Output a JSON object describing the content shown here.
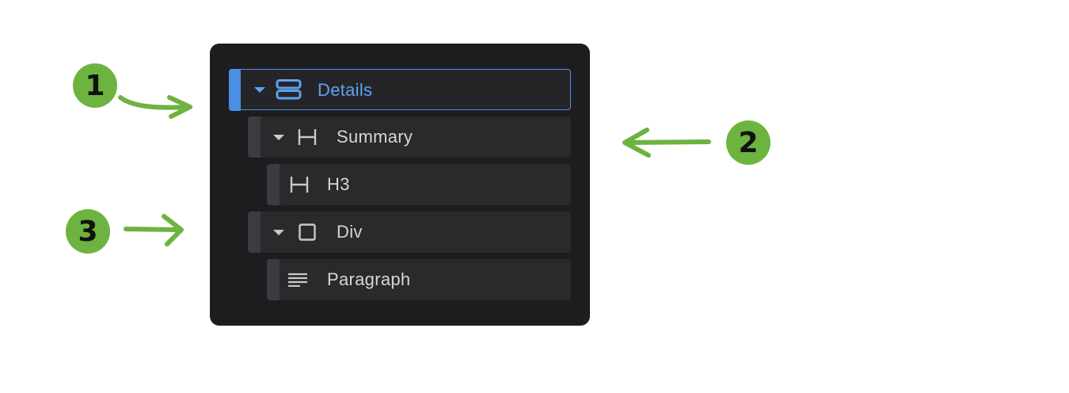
{
  "navigator": {
    "items": [
      {
        "label": "Details",
        "icon": "details-stack-icon",
        "expanded": true,
        "selected": true
      },
      {
        "label": "Summary",
        "icon": "heading-icon",
        "expanded": true,
        "selected": false
      },
      {
        "label": "H3",
        "icon": "heading-icon",
        "expanded": false,
        "selected": false
      },
      {
        "label": "Div",
        "icon": "div-box-icon",
        "expanded": true,
        "selected": false
      },
      {
        "label": "Paragraph",
        "icon": "paragraph-lines-icon",
        "expanded": false,
        "selected": false
      }
    ]
  },
  "callouts": [
    {
      "number": "1"
    },
    {
      "number": "2"
    },
    {
      "number": "3"
    }
  ],
  "colors": {
    "panel_bg": "#1d1d1f",
    "row_bg": "#2a2a2d",
    "accent_blue": "#4a90e2",
    "callout_green": "#6db33f"
  }
}
